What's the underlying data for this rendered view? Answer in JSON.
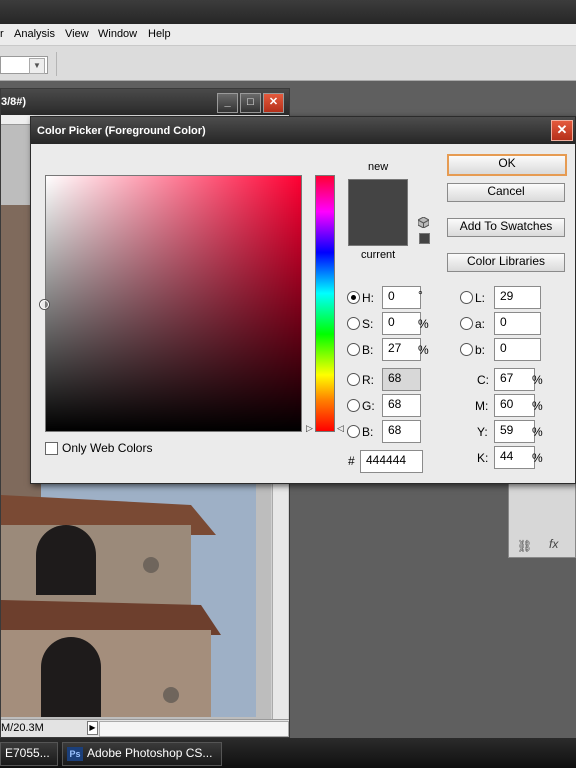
{
  "menu": [
    "Analysis",
    "View",
    "Window",
    "Help"
  ],
  "document": {
    "title_fragment": "3/8#)",
    "status_text": "M/20.3M"
  },
  "dialog": {
    "title": "Color Picker (Foreground Color)",
    "close_glyph": "✕",
    "new_label": "new",
    "current_label": "current",
    "new_color": "#444444",
    "current_color": "#444444",
    "buttons": {
      "ok": "OK",
      "cancel": "Cancel",
      "add_to_swatches": "Add To Swatches",
      "color_libraries": "Color Libraries"
    },
    "only_web_colors": "Only Web Colors",
    "hsb": {
      "h_label": "H:",
      "h_value": "0",
      "h_unit": "°",
      "s_label": "S:",
      "s_value": "0",
      "s_unit": "%",
      "b_label": "B:",
      "b_value": "27",
      "b_unit": "%"
    },
    "rgb": {
      "r_label": "R:",
      "r_value": "68",
      "g_label": "G:",
      "g_value": "68",
      "b_label": "B:",
      "b_value": "68"
    },
    "lab": {
      "l_label": "L:",
      "l_value": "29",
      "a_label": "a:",
      "a_value": "0",
      "b_label": "b:",
      "b_value": "0"
    },
    "cmyk": {
      "c_label": "C:",
      "c_value": "67",
      "m_label": "M:",
      "m_value": "60",
      "y_label": "Y:",
      "y_value": "59",
      "k_label": "K:",
      "k_value": "44",
      "unit": "%"
    },
    "hex_label": "#",
    "hex_value": "444444",
    "selected_mode": "H"
  },
  "taskbar": {
    "item1": "E7055...",
    "item2": "Adobe Photoshop CS...",
    "ps_icon": "Ps"
  }
}
